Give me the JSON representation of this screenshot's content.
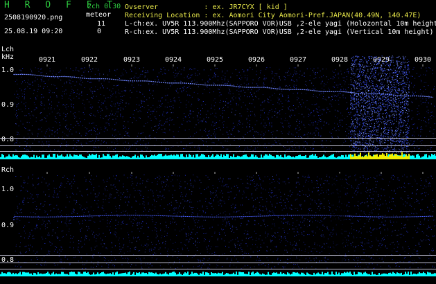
{
  "header": {
    "app_title": "H R O F F T",
    "filename": "2508190920.png",
    "datetime": "25.08.19 09:20",
    "mode": "2ch 0.30",
    "meteor_label": "meteor",
    "lch_count": "11",
    "rch_count": "0",
    "observer_line": "Ovserver           : ex. JR7CYX [ kid ]",
    "location_line": "Receiving Location : ex. Aomori City Aomori-Pref.JAPAN(40.49N, 140.47E)",
    "lch_line": "L-ch:ex. UV5R 113.900Mhz(SAPPORO VOR)USB ,2-ele yagi (Holozontal 10m height)",
    "rch_line": "R-ch:ex. UV5R 113.900Mhz(SAPPORO VOR)USB ,2-ele yagi (Vertical 10m height)"
  },
  "time_ticks": [
    "0921",
    "0922",
    "0923",
    "0924",
    "0925",
    "0926",
    "0927",
    "0928",
    "0929",
    "0930"
  ],
  "lch": {
    "label": "Lch",
    "unit": "kHz",
    "y_ticks": [
      "1.0",
      "0.9",
      "0.8"
    ]
  },
  "rch": {
    "label": "Rch",
    "y_ticks": [
      "1.0",
      "0.9",
      "0.8"
    ]
  },
  "colors": {
    "title_green": "#2ecc40",
    "noise_blue": "#2a3cff",
    "trace_blue": "#6f86ff",
    "baseline_cyan": "#00ffff",
    "burst_yellow": "#f0f000",
    "grid_line": "#c8c8dc"
  }
}
